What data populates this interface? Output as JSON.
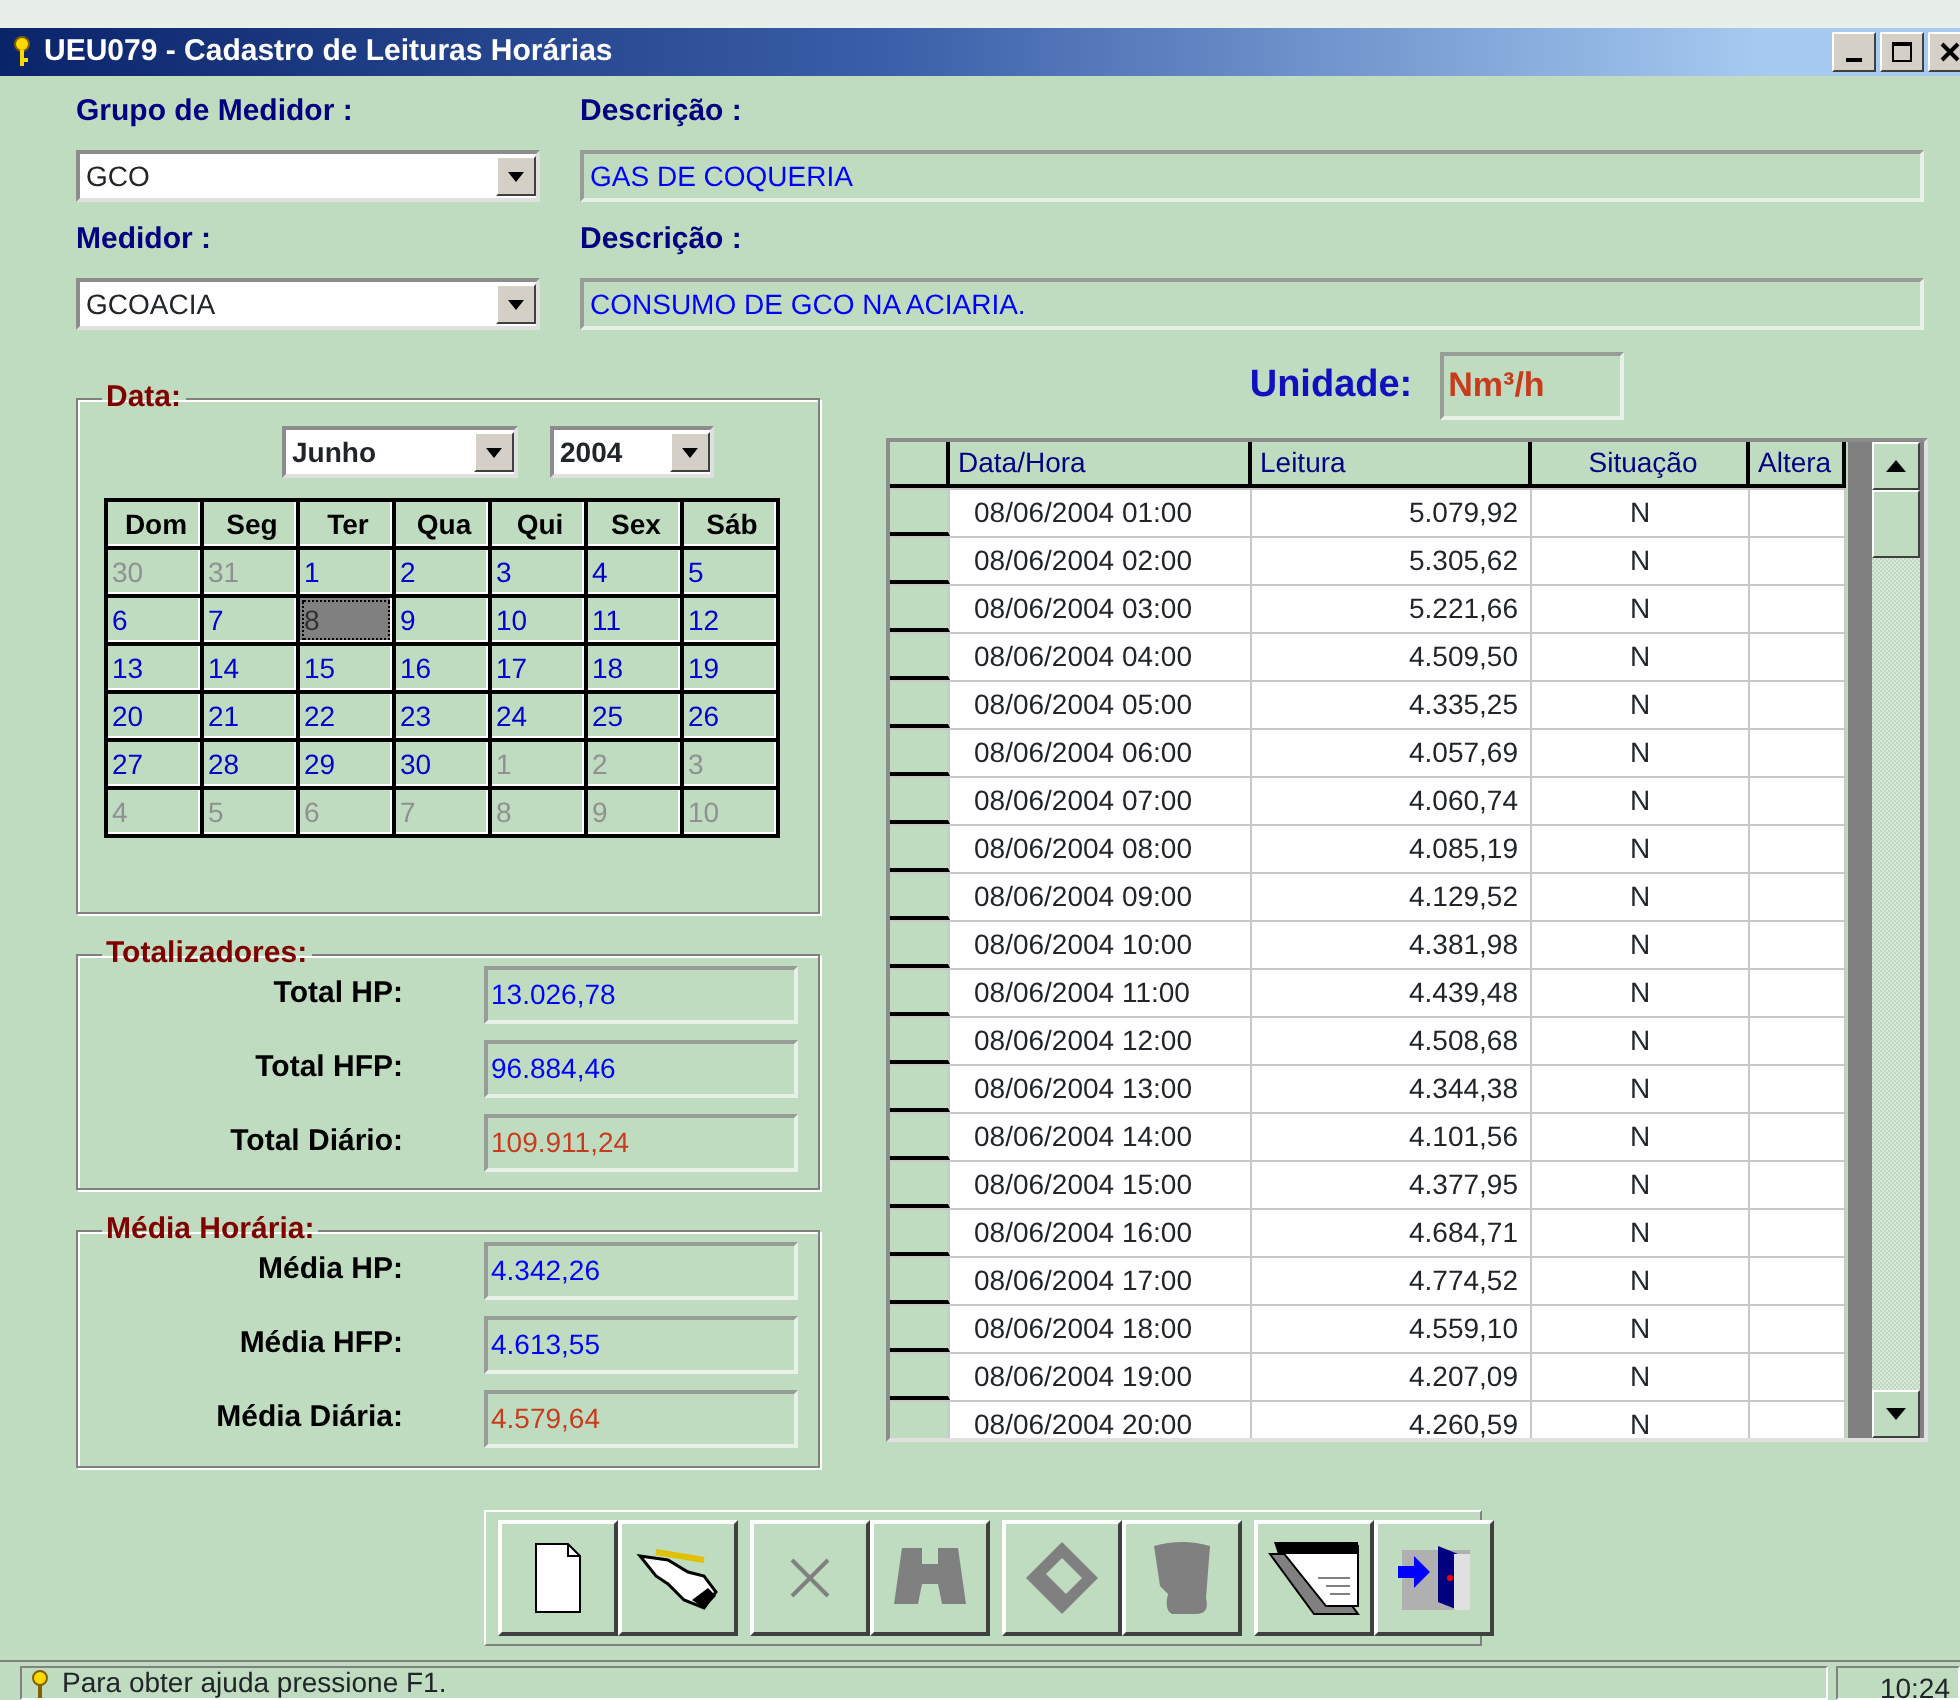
{
  "window": {
    "title": "UEU079 - Cadastro de Leituras Horárias"
  },
  "fields": [
    {
      "label": "Grupo de Medidor :",
      "value": "GCO",
      "description_label": "Descrição :",
      "description": "GAS DE COQUERIA"
    },
    {
      "label": "Medidor :",
      "value": "GCOACIA",
      "description_label": "Descrição :",
      "description": "CONSUMO DE GCO NA ACIARIA."
    }
  ],
  "date": {
    "legend": "Data:",
    "month": "Junho",
    "year": "2004",
    "weekdays": [
      "Dom",
      "Seg",
      "Ter",
      "Qua",
      "Qui",
      "Sex",
      "Sáb"
    ],
    "weeks": [
      [
        {
          "day": "30",
          "current": false,
          "selected": false
        },
        {
          "day": "31",
          "current": false,
          "selected": false
        },
        {
          "day": "1",
          "current": true,
          "selected": false
        },
        {
          "day": "2",
          "current": true,
          "selected": false
        },
        {
          "day": "3",
          "current": true,
          "selected": false
        },
        {
          "day": "4",
          "current": true,
          "selected": false
        },
        {
          "day": "5",
          "current": true,
          "selected": false
        }
      ],
      [
        {
          "day": "6",
          "current": true,
          "selected": false
        },
        {
          "day": "7",
          "current": true,
          "selected": false
        },
        {
          "day": "8",
          "current": true,
          "selected": true
        },
        {
          "day": "9",
          "current": true,
          "selected": false
        },
        {
          "day": "10",
          "current": true,
          "selected": false
        },
        {
          "day": "11",
          "current": true,
          "selected": false
        },
        {
          "day": "12",
          "current": true,
          "selected": false
        }
      ],
      [
        {
          "day": "13",
          "current": true,
          "selected": false
        },
        {
          "day": "14",
          "current": true,
          "selected": false
        },
        {
          "day": "15",
          "current": true,
          "selected": false
        },
        {
          "day": "16",
          "current": true,
          "selected": false
        },
        {
          "day": "17",
          "current": true,
          "selected": false
        },
        {
          "day": "18",
          "current": true,
          "selected": false
        },
        {
          "day": "19",
          "current": true,
          "selected": false
        }
      ],
      [
        {
          "day": "20",
          "current": true,
          "selected": false
        },
        {
          "day": "21",
          "current": true,
          "selected": false
        },
        {
          "day": "22",
          "current": true,
          "selected": false
        },
        {
          "day": "23",
          "current": true,
          "selected": false
        },
        {
          "day": "24",
          "current": true,
          "selected": false
        },
        {
          "day": "25",
          "current": true,
          "selected": false
        },
        {
          "day": "26",
          "current": true,
          "selected": false
        }
      ],
      [
        {
          "day": "27",
          "current": true,
          "selected": false
        },
        {
          "day": "28",
          "current": true,
          "selected": false
        },
        {
          "day": "29",
          "current": true,
          "selected": false
        },
        {
          "day": "30",
          "current": true,
          "selected": false
        },
        {
          "day": "1",
          "current": false,
          "selected": false
        },
        {
          "day": "2",
          "current": false,
          "selected": false
        },
        {
          "day": "3",
          "current": false,
          "selected": false
        }
      ],
      [
        {
          "day": "4",
          "current": false,
          "selected": false
        },
        {
          "day": "5",
          "current": false,
          "selected": false
        },
        {
          "day": "6",
          "current": false,
          "selected": false
        },
        {
          "day": "7",
          "current": false,
          "selected": false
        },
        {
          "day": "8",
          "current": false,
          "selected": false
        },
        {
          "day": "9",
          "current": false,
          "selected": false
        },
        {
          "day": "10",
          "current": false,
          "selected": false
        }
      ]
    ]
  },
  "totals": {
    "legend": "Totalizadores:",
    "items": [
      {
        "label": "Total HP:",
        "value": "13.026,78",
        "kind": "partial"
      },
      {
        "label": "Total HFP:",
        "value": "96.884,46",
        "kind": "partial"
      },
      {
        "label": "Total Diário:",
        "value": "109.911,24",
        "kind": "daily"
      }
    ]
  },
  "averages": {
    "legend": "Média Horária:",
    "items": [
      {
        "label": "Média HP:",
        "value": "4.342,26",
        "kind": "partial"
      },
      {
        "label": "Média HFP:",
        "value": "4.613,55",
        "kind": "partial"
      },
      {
        "label": "Média Diária:",
        "value": "4.579,64",
        "kind": "daily"
      }
    ]
  },
  "unit": {
    "label": "Unidade:",
    "value": "Nm³/h"
  },
  "grid": {
    "columns": [
      "Data/Hora",
      "Leitura",
      "Situação",
      "Altera"
    ],
    "rows": [
      {
        "datetime": "08/06/2004 01:00",
        "reading": "5.079,92",
        "status": "N"
      },
      {
        "datetime": "08/06/2004 02:00",
        "reading": "5.305,62",
        "status": "N"
      },
      {
        "datetime": "08/06/2004 03:00",
        "reading": "5.221,66",
        "status": "N"
      },
      {
        "datetime": "08/06/2004 04:00",
        "reading": "4.509,50",
        "status": "N"
      },
      {
        "datetime": "08/06/2004 05:00",
        "reading": "4.335,25",
        "status": "N"
      },
      {
        "datetime": "08/06/2004 06:00",
        "reading": "4.057,69",
        "status": "N"
      },
      {
        "datetime": "08/06/2004 07:00",
        "reading": "4.060,74",
        "status": "N"
      },
      {
        "datetime": "08/06/2004 08:00",
        "reading": "4.085,19",
        "status": "N"
      },
      {
        "datetime": "08/06/2004 09:00",
        "reading": "4.129,52",
        "status": "N"
      },
      {
        "datetime": "08/06/2004 10:00",
        "reading": "4.381,98",
        "status": "N"
      },
      {
        "datetime": "08/06/2004 11:00",
        "reading": "4.439,48",
        "status": "N"
      },
      {
        "datetime": "08/06/2004 12:00",
        "reading": "4.508,68",
        "status": "N"
      },
      {
        "datetime": "08/06/2004 13:00",
        "reading": "4.344,38",
        "status": "N"
      },
      {
        "datetime": "08/06/2004 14:00",
        "reading": "4.101,56",
        "status": "N"
      },
      {
        "datetime": "08/06/2004 15:00",
        "reading": "4.377,95",
        "status": "N"
      },
      {
        "datetime": "08/06/2004 16:00",
        "reading": "4.684,71",
        "status": "N"
      },
      {
        "datetime": "08/06/2004 17:00",
        "reading": "4.774,52",
        "status": "N"
      },
      {
        "datetime": "08/06/2004 18:00",
        "reading": "4.559,10",
        "status": "N"
      },
      {
        "datetime": "08/06/2004 19:00",
        "reading": "4.207,09",
        "status": "N"
      },
      {
        "datetime": "08/06/2004 20:00",
        "reading": "4.260,59",
        "status": "N"
      }
    ]
  },
  "toolbar": [
    [
      {
        "kind": "new",
        "disabled": false
      },
      {
        "kind": "edit",
        "disabled": false
      }
    ],
    [
      {
        "kind": "delete",
        "disabled": true
      },
      {
        "kind": "find",
        "disabled": true
      }
    ],
    [
      {
        "kind": "save",
        "disabled": true
      },
      {
        "kind": "undo",
        "disabled": true
      }
    ],
    [
      {
        "kind": "report",
        "disabled": false
      },
      {
        "kind": "exit",
        "disabled": false
      }
    ]
  ],
  "status_bar": {
    "text": "Para obter ajuda pressione F1.",
    "time": "10:24"
  }
}
